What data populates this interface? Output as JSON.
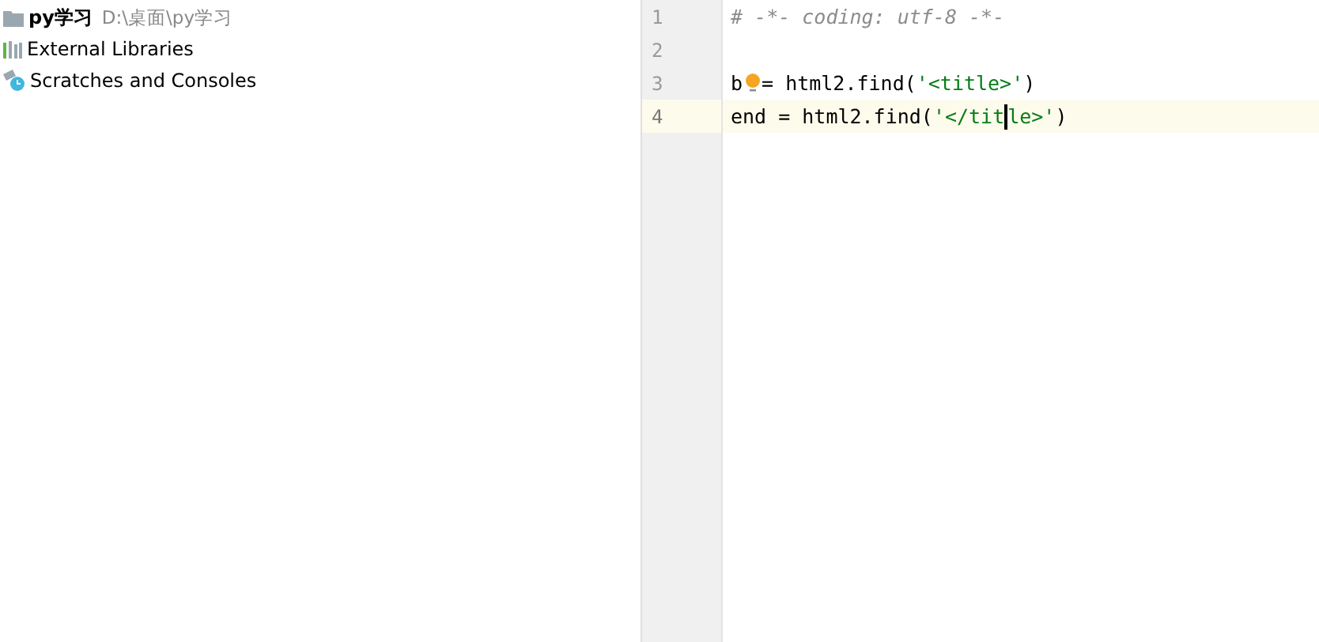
{
  "project_tree": [
    {
      "kind": "folder",
      "label": "py学习",
      "path": "D:\\桌面\\py学习"
    },
    {
      "kind": "libraries",
      "label": "External Libraries"
    },
    {
      "kind": "scratches",
      "label": "Scratches and Consoles"
    }
  ],
  "editor": {
    "lines": [
      {
        "number": "1",
        "current": false,
        "tokens": [
          {
            "kind": "comment",
            "text": "# -*- coding: utf-8 -*-"
          }
        ]
      },
      {
        "number": "2",
        "current": false
      },
      {
        "number": "3",
        "current": false,
        "tokens": [
          {
            "kind": "plain",
            "text": "b"
          },
          {
            "kind": "bulb"
          },
          {
            "kind": "plain",
            "text": "= html2.find("
          },
          {
            "kind": "string",
            "text": "'<title>'"
          },
          {
            "kind": "plain",
            "text": ")"
          }
        ]
      },
      {
        "number": "4",
        "current": true,
        "tokens": [
          {
            "kind": "plain",
            "text": "end = html2.find("
          },
          {
            "kind": "string",
            "text": "'</tit"
          },
          {
            "kind": "caret"
          },
          {
            "kind": "string",
            "text": "le>'"
          },
          {
            "kind": "plain",
            "text": ")"
          }
        ]
      }
    ]
  }
}
